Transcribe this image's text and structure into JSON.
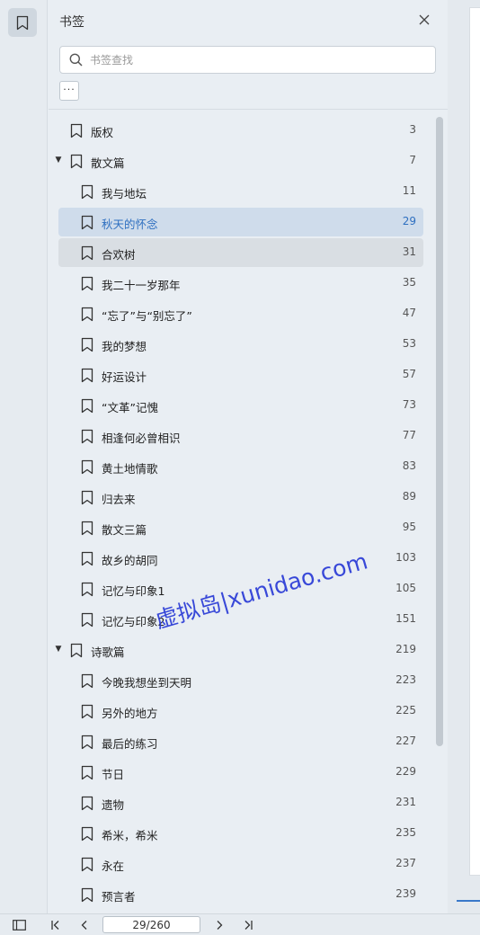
{
  "rail": {
    "bookmark_icon": "bookmark-icon"
  },
  "panel": {
    "title": "书签",
    "close_icon": "close-icon",
    "search": {
      "placeholder": "书签查找",
      "value": ""
    },
    "more_label": "···"
  },
  "bookmarks": [
    {
      "label": "版权",
      "page": "3",
      "level": 0,
      "expanded": null,
      "state": ""
    },
    {
      "label": "散文篇",
      "page": "7",
      "level": 0,
      "expanded": true,
      "state": ""
    },
    {
      "label": "我与地坛",
      "page": "11",
      "level": 1,
      "expanded": null,
      "state": ""
    },
    {
      "label": "秋天的怀念",
      "page": "29",
      "level": 1,
      "expanded": null,
      "state": "selected"
    },
    {
      "label": "合欢树",
      "page": "31",
      "level": 1,
      "expanded": null,
      "state": "hovered"
    },
    {
      "label": "我二十一岁那年",
      "page": "35",
      "level": 1,
      "expanded": null,
      "state": ""
    },
    {
      "label": "“忘了”与“别忘了”",
      "page": "47",
      "level": 1,
      "expanded": null,
      "state": ""
    },
    {
      "label": "我的梦想",
      "page": "53",
      "level": 1,
      "expanded": null,
      "state": ""
    },
    {
      "label": "好运设计",
      "page": "57",
      "level": 1,
      "expanded": null,
      "state": ""
    },
    {
      "label": "“文革”记愧",
      "page": "73",
      "level": 1,
      "expanded": null,
      "state": ""
    },
    {
      "label": "相逢何必曾相识",
      "page": "77",
      "level": 1,
      "expanded": null,
      "state": ""
    },
    {
      "label": "黄土地情歌",
      "page": "83",
      "level": 1,
      "expanded": null,
      "state": ""
    },
    {
      "label": "归去来",
      "page": "89",
      "level": 1,
      "expanded": null,
      "state": ""
    },
    {
      "label": "散文三篇",
      "page": "95",
      "level": 1,
      "expanded": null,
      "state": ""
    },
    {
      "label": "故乡的胡同",
      "page": "103",
      "level": 1,
      "expanded": null,
      "state": ""
    },
    {
      "label": "记忆与印象1",
      "page": "105",
      "level": 1,
      "expanded": null,
      "state": ""
    },
    {
      "label": "记忆与印象2",
      "page": "151",
      "level": 1,
      "expanded": null,
      "state": ""
    },
    {
      "label": "诗歌篇",
      "page": "219",
      "level": 0,
      "expanded": true,
      "state": ""
    },
    {
      "label": "今晚我想坐到天明",
      "page": "223",
      "level": 1,
      "expanded": null,
      "state": ""
    },
    {
      "label": "另外的地方",
      "page": "225",
      "level": 1,
      "expanded": null,
      "state": ""
    },
    {
      "label": "最后的练习",
      "page": "227",
      "level": 1,
      "expanded": null,
      "state": ""
    },
    {
      "label": "节日",
      "page": "229",
      "level": 1,
      "expanded": null,
      "state": ""
    },
    {
      "label": "遗物",
      "page": "231",
      "level": 1,
      "expanded": null,
      "state": ""
    },
    {
      "label": "希米，希米",
      "page": "235",
      "level": 1,
      "expanded": null,
      "state": ""
    },
    {
      "label": "永在",
      "page": "237",
      "level": 1,
      "expanded": null,
      "state": ""
    },
    {
      "label": "预言者",
      "page": "239",
      "level": 1,
      "expanded": null,
      "state": ""
    }
  ],
  "bottombar": {
    "page_value": "29/260",
    "icons": [
      "sidebar-toggle-icon",
      "first-page-icon",
      "prev-page-icon",
      "next-page-icon",
      "last-page-icon"
    ]
  },
  "watermark": "虚拟岛|xunidao.com",
  "colors": {
    "selected_bg": "#cfdceb",
    "selected_text": "#2e6fc0",
    "watermark": "#2a3bd6"
  }
}
